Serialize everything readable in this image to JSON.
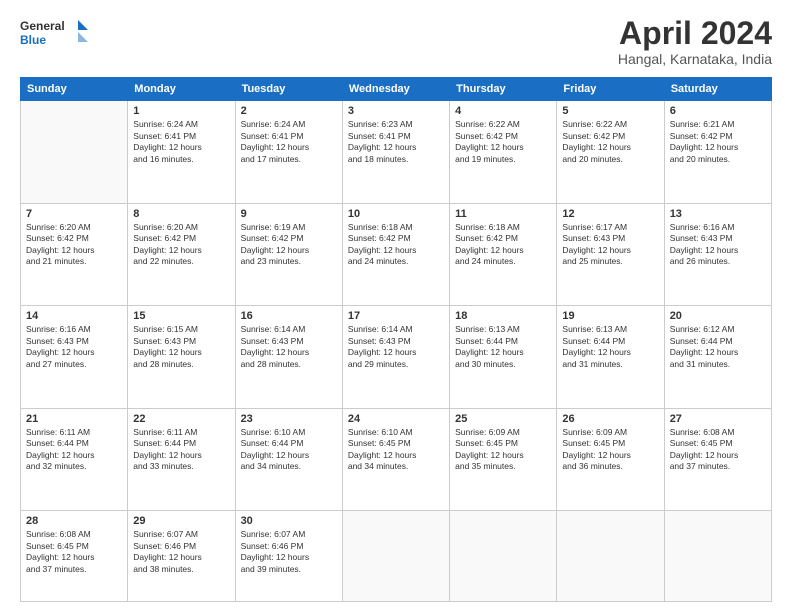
{
  "header": {
    "logo_line1": "General",
    "logo_line2": "Blue",
    "title": "April 2024",
    "subtitle": "Hangal, Karnataka, India"
  },
  "days_of_week": [
    "Sunday",
    "Monday",
    "Tuesday",
    "Wednesday",
    "Thursday",
    "Friday",
    "Saturday"
  ],
  "weeks": [
    [
      {
        "day": "",
        "sunrise": "",
        "sunset": "",
        "daylight": ""
      },
      {
        "day": "1",
        "sunrise": "6:24 AM",
        "sunset": "6:41 PM",
        "daylight": "12 hours and 16 minutes."
      },
      {
        "day": "2",
        "sunrise": "6:24 AM",
        "sunset": "6:41 PM",
        "daylight": "12 hours and 17 minutes."
      },
      {
        "day": "3",
        "sunrise": "6:23 AM",
        "sunset": "6:41 PM",
        "daylight": "12 hours and 18 minutes."
      },
      {
        "day": "4",
        "sunrise": "6:22 AM",
        "sunset": "6:42 PM",
        "daylight": "12 hours and 19 minutes."
      },
      {
        "day": "5",
        "sunrise": "6:22 AM",
        "sunset": "6:42 PM",
        "daylight": "12 hours and 20 minutes."
      },
      {
        "day": "6",
        "sunrise": "6:21 AM",
        "sunset": "6:42 PM",
        "daylight": "12 hours and 20 minutes."
      }
    ],
    [
      {
        "day": "7",
        "sunrise": "6:20 AM",
        "sunset": "6:42 PM",
        "daylight": "12 hours and 21 minutes."
      },
      {
        "day": "8",
        "sunrise": "6:20 AM",
        "sunset": "6:42 PM",
        "daylight": "12 hours and 22 minutes."
      },
      {
        "day": "9",
        "sunrise": "6:19 AM",
        "sunset": "6:42 PM",
        "daylight": "12 hours and 23 minutes."
      },
      {
        "day": "10",
        "sunrise": "6:18 AM",
        "sunset": "6:42 PM",
        "daylight": "12 hours and 24 minutes."
      },
      {
        "day": "11",
        "sunrise": "6:18 AM",
        "sunset": "6:42 PM",
        "daylight": "12 hours and 24 minutes."
      },
      {
        "day": "12",
        "sunrise": "6:17 AM",
        "sunset": "6:43 PM",
        "daylight": "12 hours and 25 minutes."
      },
      {
        "day": "13",
        "sunrise": "6:16 AM",
        "sunset": "6:43 PM",
        "daylight": "12 hours and 26 minutes."
      }
    ],
    [
      {
        "day": "14",
        "sunrise": "6:16 AM",
        "sunset": "6:43 PM",
        "daylight": "12 hours and 27 minutes."
      },
      {
        "day": "15",
        "sunrise": "6:15 AM",
        "sunset": "6:43 PM",
        "daylight": "12 hours and 28 minutes."
      },
      {
        "day": "16",
        "sunrise": "6:14 AM",
        "sunset": "6:43 PM",
        "daylight": "12 hours and 28 minutes."
      },
      {
        "day": "17",
        "sunrise": "6:14 AM",
        "sunset": "6:43 PM",
        "daylight": "12 hours and 29 minutes."
      },
      {
        "day": "18",
        "sunrise": "6:13 AM",
        "sunset": "6:44 PM",
        "daylight": "12 hours and 30 minutes."
      },
      {
        "day": "19",
        "sunrise": "6:13 AM",
        "sunset": "6:44 PM",
        "daylight": "12 hours and 31 minutes."
      },
      {
        "day": "20",
        "sunrise": "6:12 AM",
        "sunset": "6:44 PM",
        "daylight": "12 hours and 31 minutes."
      }
    ],
    [
      {
        "day": "21",
        "sunrise": "6:11 AM",
        "sunset": "6:44 PM",
        "daylight": "12 hours and 32 minutes."
      },
      {
        "day": "22",
        "sunrise": "6:11 AM",
        "sunset": "6:44 PM",
        "daylight": "12 hours and 33 minutes."
      },
      {
        "day": "23",
        "sunrise": "6:10 AM",
        "sunset": "6:44 PM",
        "daylight": "12 hours and 34 minutes."
      },
      {
        "day": "24",
        "sunrise": "6:10 AM",
        "sunset": "6:45 PM",
        "daylight": "12 hours and 34 minutes."
      },
      {
        "day": "25",
        "sunrise": "6:09 AM",
        "sunset": "6:45 PM",
        "daylight": "12 hours and 35 minutes."
      },
      {
        "day": "26",
        "sunrise": "6:09 AM",
        "sunset": "6:45 PM",
        "daylight": "12 hours and 36 minutes."
      },
      {
        "day": "27",
        "sunrise": "6:08 AM",
        "sunset": "6:45 PM",
        "daylight": "12 hours and 37 minutes."
      }
    ],
    [
      {
        "day": "28",
        "sunrise": "6:08 AM",
        "sunset": "6:45 PM",
        "daylight": "12 hours and 37 minutes."
      },
      {
        "day": "29",
        "sunrise": "6:07 AM",
        "sunset": "6:46 PM",
        "daylight": "12 hours and 38 minutes."
      },
      {
        "day": "30",
        "sunrise": "6:07 AM",
        "sunset": "6:46 PM",
        "daylight": "12 hours and 39 minutes."
      },
      {
        "day": "",
        "sunrise": "",
        "sunset": "",
        "daylight": ""
      },
      {
        "day": "",
        "sunrise": "",
        "sunset": "",
        "daylight": ""
      },
      {
        "day": "",
        "sunrise": "",
        "sunset": "",
        "daylight": ""
      },
      {
        "day": "",
        "sunrise": "",
        "sunset": "",
        "daylight": ""
      }
    ]
  ],
  "labels": {
    "sunrise": "Sunrise:",
    "sunset": "Sunset:",
    "daylight": "Daylight:"
  }
}
